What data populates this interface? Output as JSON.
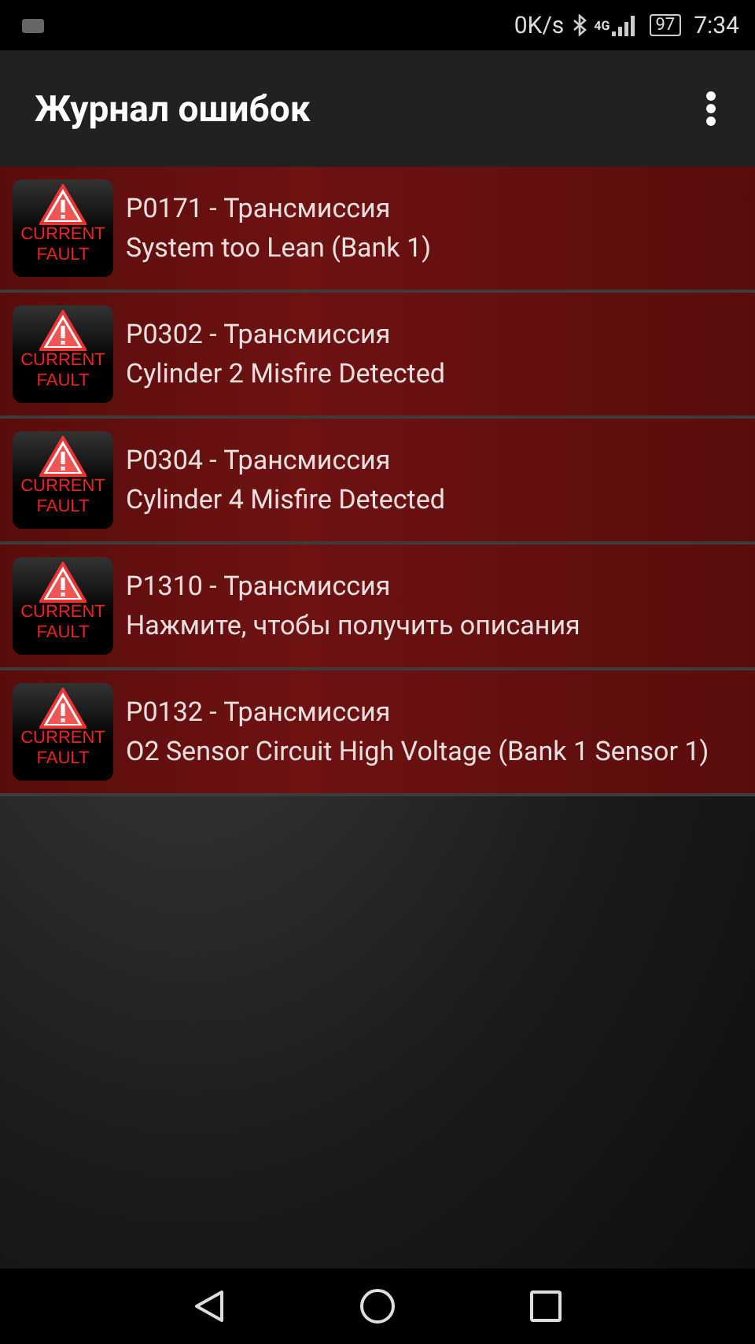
{
  "status_bar": {
    "speed": "0K/s",
    "network": "4G",
    "battery": "97",
    "time": "7:34"
  },
  "app_bar": {
    "title": "Журнал ошибок"
  },
  "faults": [
    {
      "badge": [
        "CURRENT",
        "FAULT"
      ],
      "code": "P0171 - Трансмиссия",
      "description": "System too Lean (Bank 1)"
    },
    {
      "badge": [
        "CURRENT",
        "FAULT"
      ],
      "code": "P0302 - Трансмиссия",
      "description": "Cylinder 2 Misfire Detected"
    },
    {
      "badge": [
        "CURRENT",
        "FAULT"
      ],
      "code": "P0304 - Трансмиссия",
      "description": "Cylinder 4 Misfire Detected"
    },
    {
      "badge": [
        "CURRENT",
        "FAULT"
      ],
      "code": "P1310 - Трансмиссия",
      "description": "Нажмите, чтобы получить описания"
    },
    {
      "badge": [
        "CURRENT",
        "FAULT"
      ],
      "code": "P0132 - Трансмиссия",
      "description": "O2 Sensor Circuit High Voltage (Bank 1 Sensor 1)"
    }
  ]
}
